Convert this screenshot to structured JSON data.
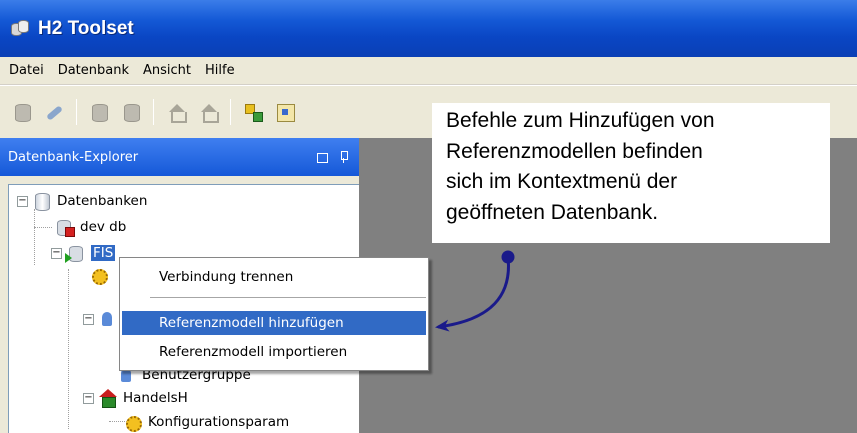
{
  "window": {
    "title": "H2 Toolset",
    "app_icon": "database-stack-icon"
  },
  "menubar": {
    "items": [
      "Datei",
      "Datenbank",
      "Ansicht",
      "Hilfe"
    ]
  },
  "toolbar": {
    "buttons": [
      "connect-db-icon",
      "plug-icon",
      "db-gray-icon",
      "db-gray-icon",
      "house-icon",
      "house-icon",
      "tree-structure-icon",
      "grid-table-icon"
    ]
  },
  "explorer": {
    "title": "Datenbank-Explorer",
    "tree": {
      "root": "Datenbanken",
      "db1": "dev db",
      "db2": "FIS",
      "node_partial": "Benutzergruppe",
      "node_handels": "HandelsH",
      "node_konfig": "Konfigurationsparam"
    }
  },
  "context_menu": {
    "items": [
      {
        "label": "Verbindung trennen",
        "active": false
      },
      {
        "label": "Referenzmodell hinzufügen",
        "active": true
      },
      {
        "label": "Referenzmodell importieren",
        "active": false
      }
    ]
  },
  "annotation": {
    "text": "Befehle zum Hinzufügen von\nReferenzmodellen befinden\nsich im Kontextmenü der\ngeöffneten Datenbank."
  },
  "colors": {
    "titlebar": "#0a46c4",
    "selection": "#316ac5",
    "workspace": "#808080",
    "arrow": "#1a1a8a"
  }
}
